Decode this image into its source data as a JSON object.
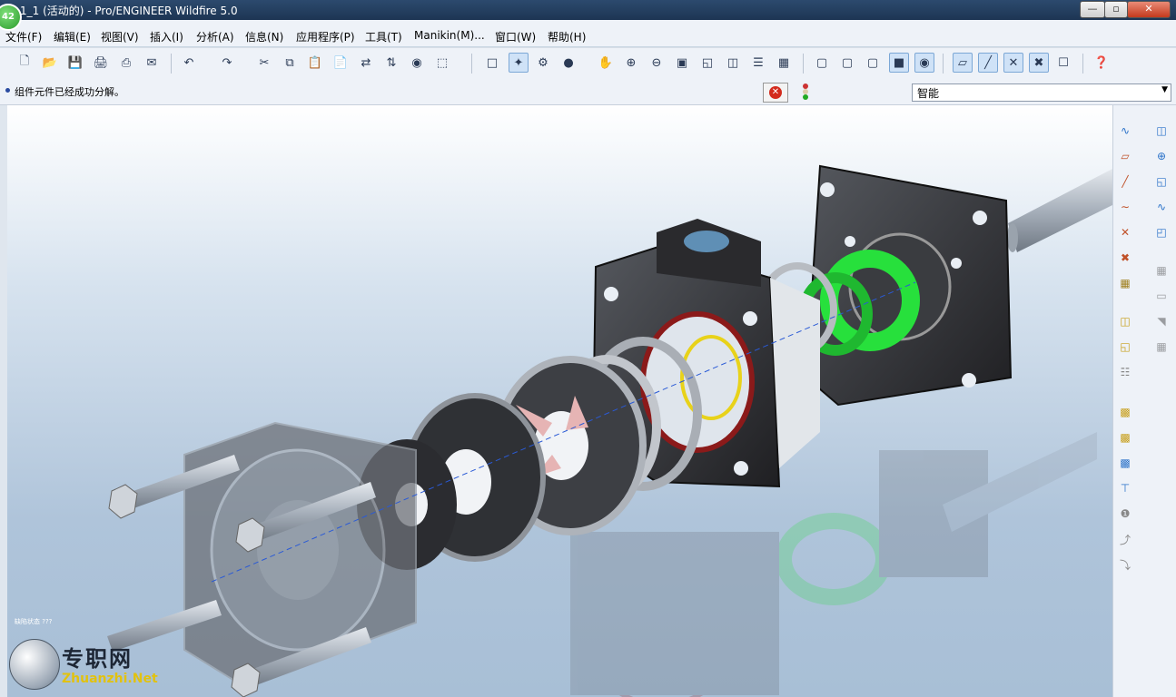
{
  "window": {
    "title": "1_1 (活动的) - Pro/ENGINEER Wildfire 5.0",
    "badge": "42"
  },
  "menu": [
    "文件(F)",
    "编辑(E)",
    "视图(V)",
    "插入(I)",
    "分析(A)",
    "信息(N)",
    "应用程序(P)",
    "工具(T)",
    "Manikin(M)...",
    "窗口(W)",
    "帮助(H)"
  ],
  "status": {
    "message": "组件元件已经成功分解。",
    "filter_value": "智能"
  },
  "viewport": {
    "corner_label": "缺陷状态 ???"
  },
  "watermark": {
    "chinese": "专职网",
    "english": "Zhuanzhi.Net"
  },
  "toolbar_icons": [
    "new-file",
    "open-file",
    "save",
    "print",
    "print-preview",
    "email",
    "undo",
    "redo",
    "cut",
    "copy",
    "paste",
    "paste-special",
    "regenerate",
    "regenerate-manager",
    "find",
    "select-box",
    "repaint",
    "spin-center",
    "view-manager",
    "shade",
    "orient",
    "zoom-in",
    "zoom-out",
    "refit",
    "reorient",
    "saved-views",
    "layers",
    "model-display",
    "wireframe",
    "hidden-line",
    "no-hidden",
    "shading",
    "enhanced-realism",
    "datum-planes",
    "datum-axes",
    "datum-points",
    "coordinate-systems",
    "annotations",
    "context-help"
  ],
  "right_toolbar_icons": [
    "sketch",
    "datum-plane",
    "datum-axis",
    "datum-curve",
    "datum-point",
    "offset-csys",
    "coordinate-system",
    "analysis",
    "component-place",
    "interface",
    "repeat",
    "pattern",
    "mirror",
    "template",
    "flexible",
    "cable",
    "wire"
  ],
  "colors": {
    "accent_green": "#27e03c",
    "seal_red": "#8b1a1a",
    "ring_yellow": "#e8d21a",
    "part_dark": "#2d2d2f",
    "part_gray": "#8c9096"
  }
}
